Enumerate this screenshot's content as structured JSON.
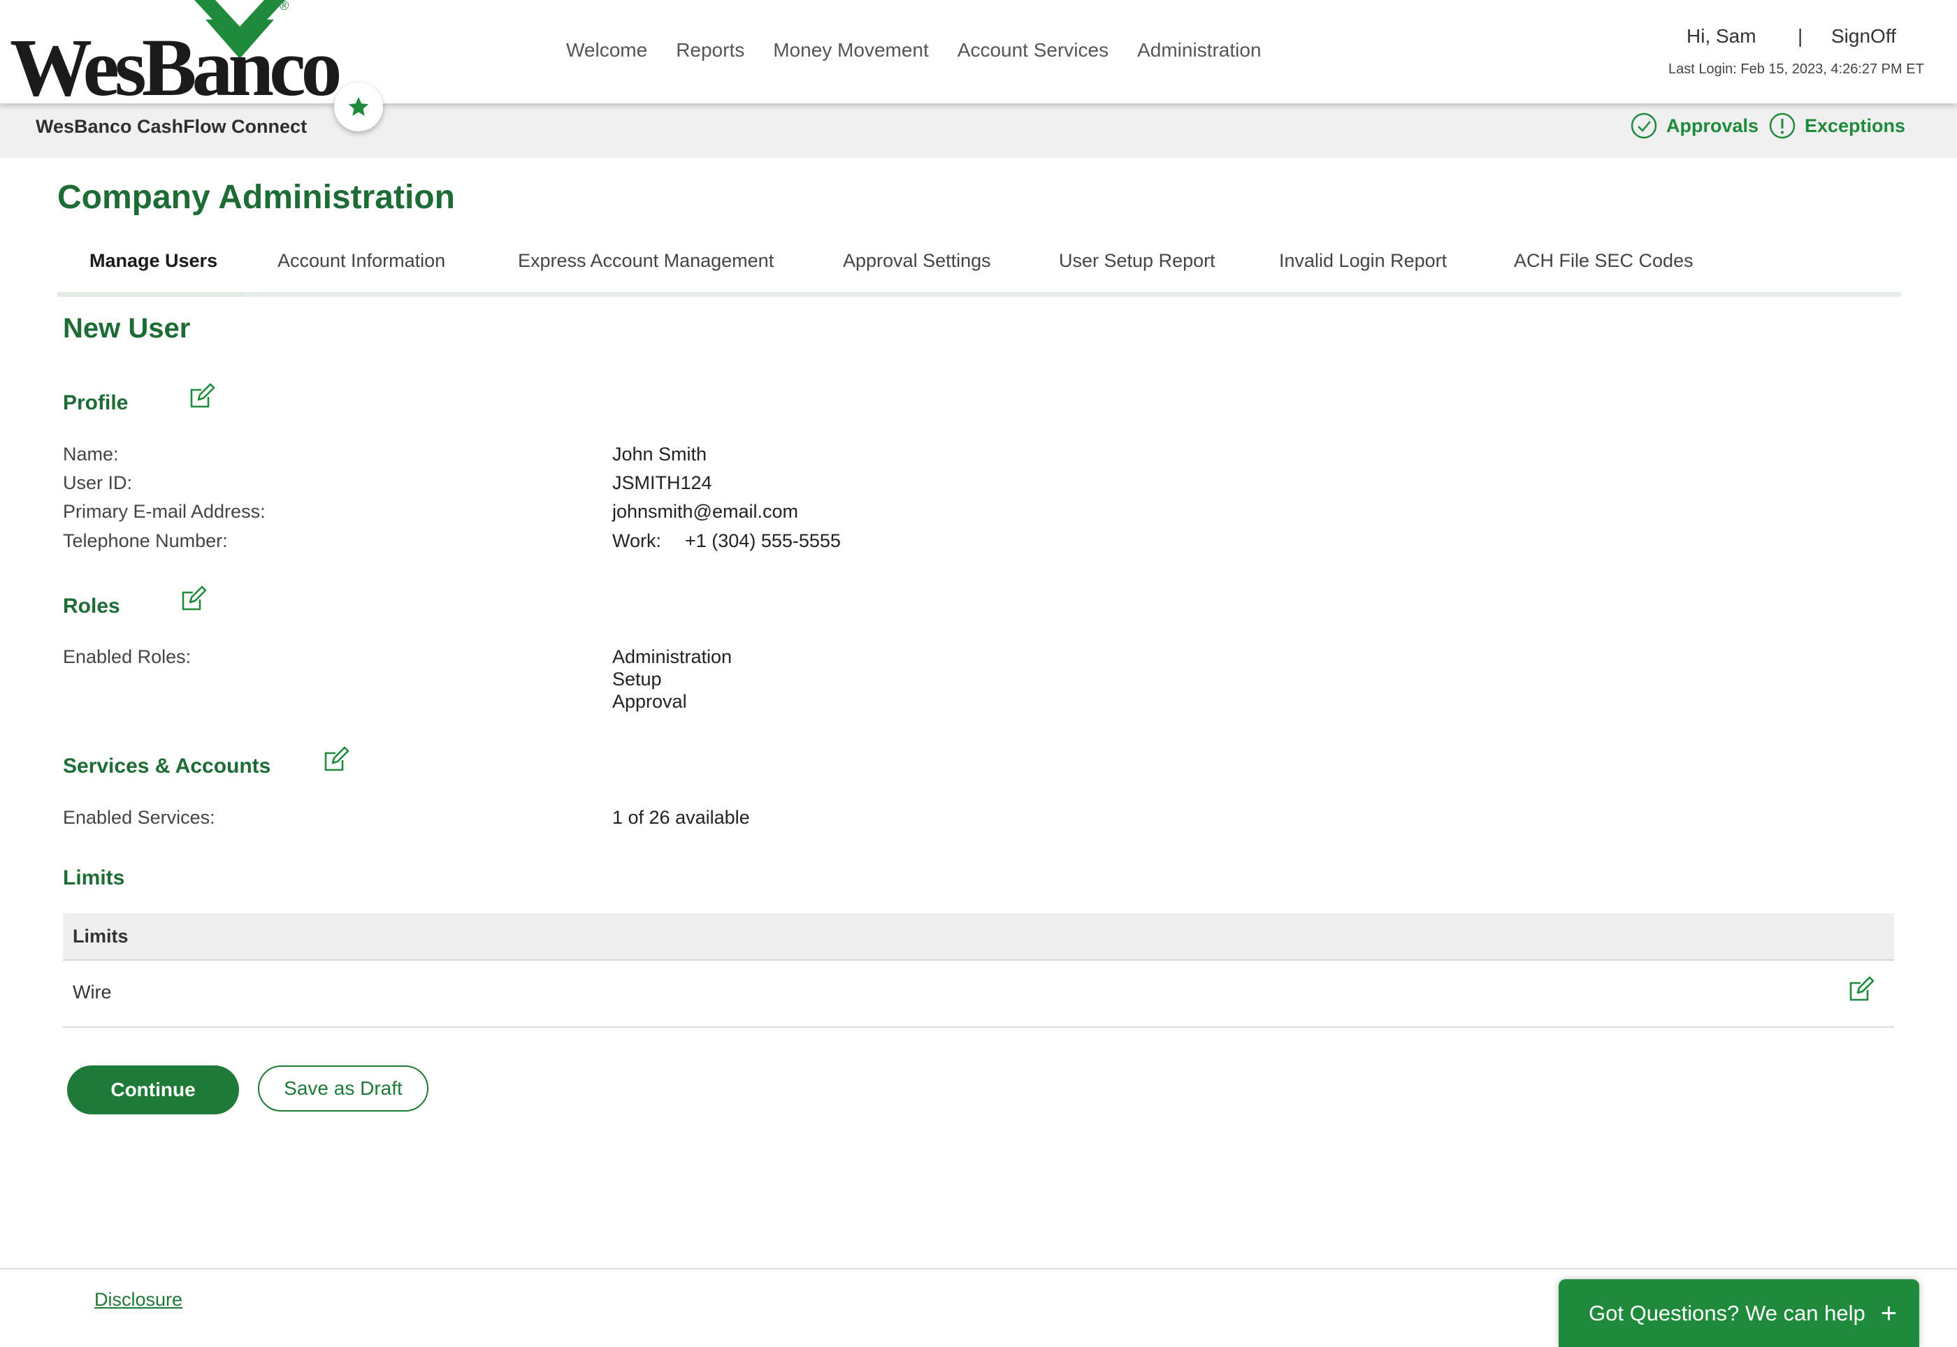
{
  "brand": {
    "logo_text": "WesBanco",
    "logo_reg": "®",
    "subtitle": "WesBanco CashFlow Connect",
    "accent_color": "#1f8a3b",
    "dark_green": "#1d6b35"
  },
  "nav": {
    "items": [
      "Welcome",
      "Reports",
      "Money Movement",
      "Account Services",
      "Administration"
    ]
  },
  "user": {
    "greeting": "Hi, Sam",
    "separator": "|",
    "signoff": "SignOff",
    "last_login": "Last Login: Feb 15, 2023, 4:26:27 PM ET"
  },
  "quick_links": {
    "approvals": "Approvals",
    "exceptions": "Exceptions"
  },
  "page": {
    "title": "Company Administration"
  },
  "tabs": [
    {
      "label": "Manage Users",
      "active": true
    },
    {
      "label": "Account Information",
      "active": false
    },
    {
      "label": "Express Account Management",
      "active": false
    },
    {
      "label": "Approval Settings",
      "active": false
    },
    {
      "label": "User Setup Report",
      "active": false
    },
    {
      "label": "Invalid Login Report",
      "active": false
    },
    {
      "label": "ACH File SEC Codes",
      "active": false
    }
  ],
  "form": {
    "heading": "New User",
    "profile": {
      "title": "Profile",
      "name_label": "Name:",
      "name_value": "John Smith",
      "userid_label": "User ID:",
      "userid_value": "JSMITH124",
      "email_label": "Primary E-mail Address:",
      "email_value": "johnsmith@email.com",
      "phone_label": "Telephone Number:",
      "phone_type": "Work:",
      "phone_value": "+1 (304) 555-5555"
    },
    "roles": {
      "title": "Roles",
      "label": "Enabled Roles:",
      "values": [
        "Administration",
        "Setup",
        "Approval"
      ]
    },
    "services": {
      "title": "Services & Accounts",
      "label": "Enabled Services:",
      "value": "1 of 26 available"
    },
    "limits": {
      "title": "Limits",
      "table_header": "Limits",
      "rows": [
        "Wire"
      ]
    }
  },
  "actions": {
    "continue": "Continue",
    "save_draft": "Save as Draft"
  },
  "footer": {
    "disclosure": "Disclosure",
    "help": "Got Questions? We can help",
    "help_plus": "+"
  }
}
